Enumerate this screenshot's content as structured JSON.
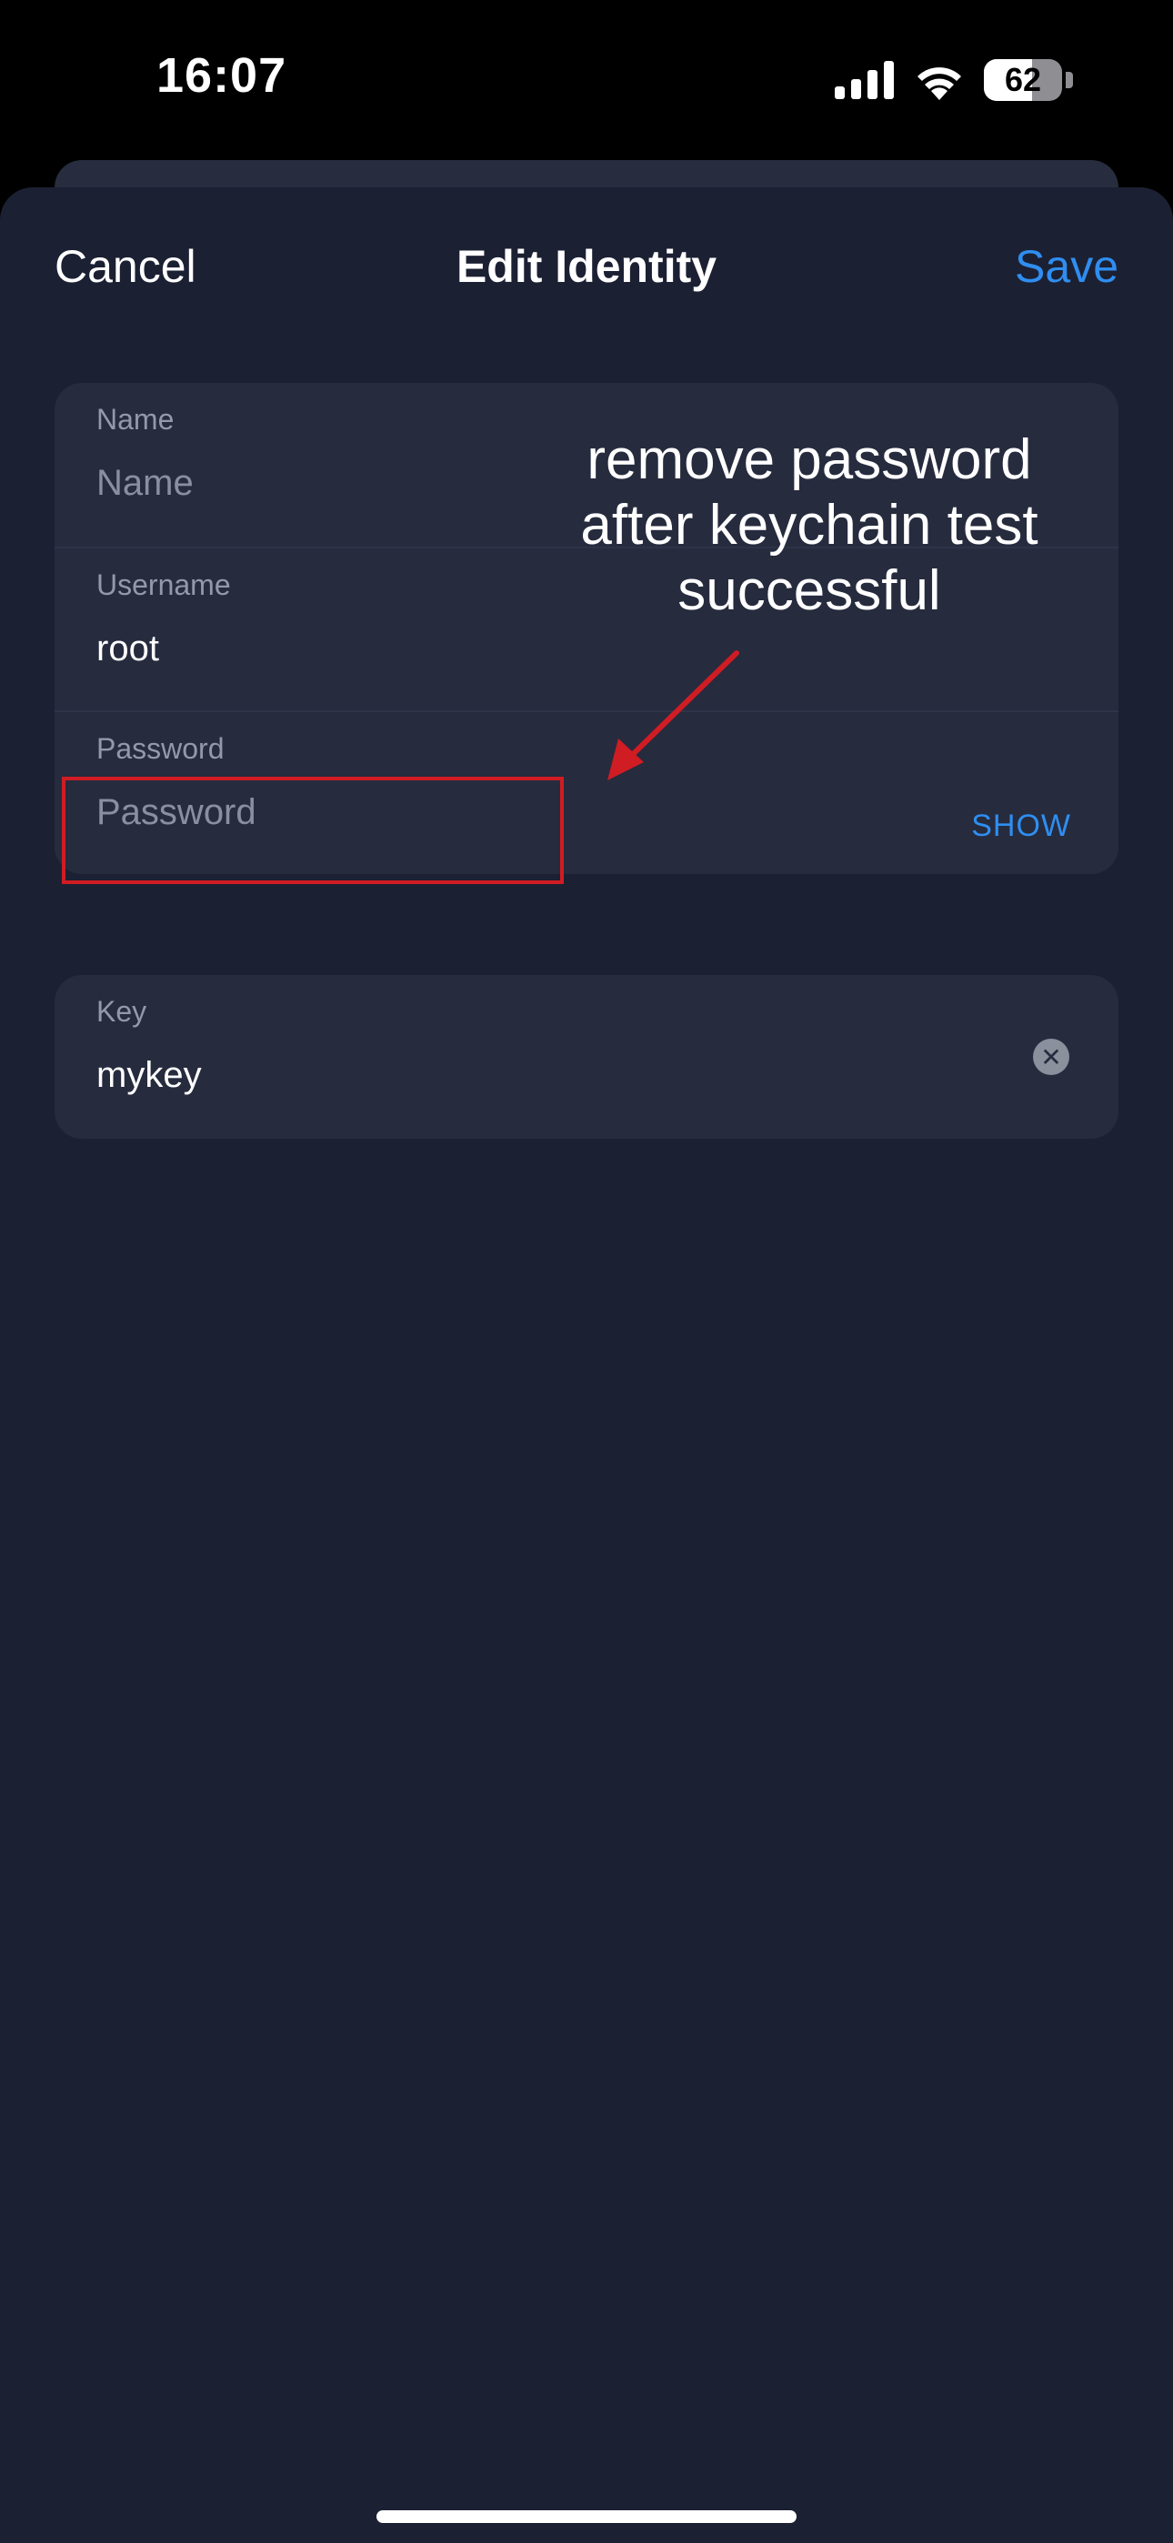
{
  "status_bar": {
    "time": "16:07",
    "battery_percent": "62",
    "battery_level": 0.62,
    "icons": [
      "cellular-signal-icon",
      "wifi-icon",
      "battery-icon"
    ]
  },
  "nav": {
    "cancel_label": "Cancel",
    "title": "Edit Identity",
    "save_label": "Save"
  },
  "identity": {
    "name_label": "Name",
    "name_placeholder": "Name",
    "name_value": "",
    "username_label": "Username",
    "username_value": "root",
    "password_label": "Password",
    "password_placeholder": "Password",
    "password_value": "",
    "show_label": "SHOW"
  },
  "key": {
    "label": "Key",
    "value": "mykey",
    "clear_icon": "clear-circle-icon"
  },
  "annotation": {
    "line1": "remove password",
    "line2": "after keychain test",
    "line3": "successful",
    "color": "#d01c23"
  },
  "colors": {
    "accent": "#2f8ef0",
    "background": "#1c2033",
    "card": "#262b3e"
  }
}
